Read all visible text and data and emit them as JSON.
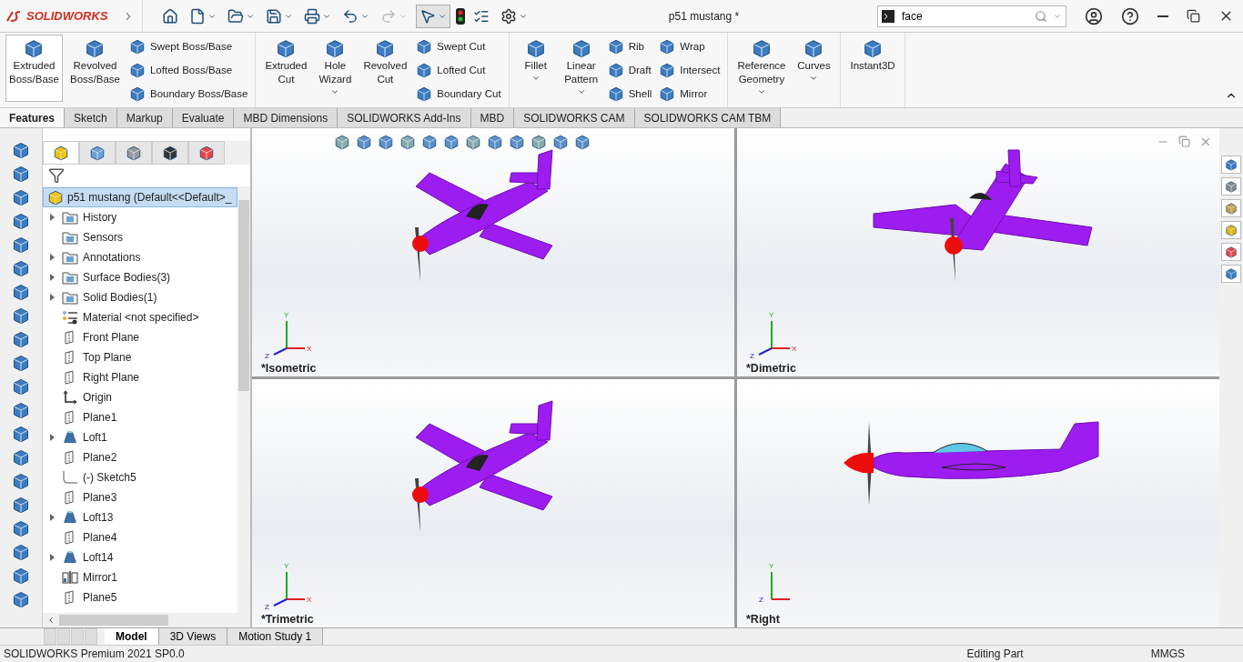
{
  "app": {
    "logo": "SOLIDWORKS",
    "title": "p51 mustang *",
    "search": {
      "value": "face"
    }
  },
  "ribbon": [
    {
      "items": [
        {
          "kind": "large",
          "lines": [
            "Extruded",
            "Boss/Base"
          ],
          "selected": true,
          "dropdown": false
        },
        {
          "kind": "large",
          "lines": [
            "Revolved",
            "Boss/Base"
          ],
          "selected": false,
          "dropdown": false
        },
        {
          "kind": "stack",
          "labels": [
            "Swept Boss/Base",
            "Lofted Boss/Base",
            "Boundary Boss/Base"
          ]
        }
      ]
    },
    {
      "items": [
        {
          "kind": "large",
          "lines": [
            "Extruded",
            "Cut"
          ],
          "selected": false,
          "dropdown": false
        },
        {
          "kind": "large",
          "lines": [
            "Hole",
            "Wizard"
          ],
          "selected": false,
          "dropdown": true
        },
        {
          "kind": "large",
          "lines": [
            "Revolved",
            "Cut"
          ],
          "selected": false,
          "dropdown": false
        },
        {
          "kind": "stack",
          "labels": [
            "Swept Cut",
            "Lofted Cut",
            "Boundary Cut"
          ]
        }
      ]
    },
    {
      "items": [
        {
          "kind": "large",
          "lines": [
            "Fillet"
          ],
          "selected": false,
          "dropdown": true
        },
        {
          "kind": "large",
          "lines": [
            "Linear",
            "Pattern"
          ],
          "selected": false,
          "dropdown": true
        },
        {
          "kind": "stack",
          "labels": [
            "Rib",
            "Draft",
            "Shell"
          ]
        },
        {
          "kind": "stack",
          "labels": [
            "Wrap",
            "Intersect",
            "Mirror"
          ]
        }
      ]
    },
    {
      "items": [
        {
          "kind": "large",
          "lines": [
            "Reference",
            "Geometry"
          ],
          "selected": false,
          "dropdown": true
        },
        {
          "kind": "large",
          "lines": [
            "Curves"
          ],
          "selected": false,
          "dropdown": true
        }
      ]
    },
    {
      "items": [
        {
          "kind": "large",
          "lines": [
            "Instant3D"
          ],
          "selected": false,
          "dropdown": false
        }
      ]
    }
  ],
  "command_tabs": [
    {
      "label": "Features",
      "selected": true
    },
    {
      "label": "Sketch",
      "selected": false
    },
    {
      "label": "Markup",
      "selected": false
    },
    {
      "label": "Evaluate",
      "selected": false
    },
    {
      "label": "MBD Dimensions",
      "selected": false
    },
    {
      "label": "SOLIDWORKS Add-Ins",
      "selected": false
    },
    {
      "label": "MBD",
      "selected": false
    },
    {
      "label": "SOLIDWORKS CAM",
      "selected": false
    },
    {
      "label": "SOLIDWORKS CAM TBM",
      "selected": false
    }
  ],
  "manager_tabs": [
    {
      "selected": true
    },
    {
      "selected": false
    },
    {
      "selected": false
    },
    {
      "selected": false
    },
    {
      "selected": false
    }
  ],
  "tree": {
    "root": {
      "label": "p51 mustang  (Default<<Default>_",
      "selected": true
    },
    "items": [
      {
        "label": "History",
        "kind": "folder",
        "expandable": true
      },
      {
        "label": "Sensors",
        "kind": "folder",
        "expandable": false
      },
      {
        "label": "Annotations",
        "kind": "folder",
        "expandable": true
      },
      {
        "label": "Surface Bodies(3)",
        "kind": "folder",
        "expandable": true
      },
      {
        "label": "Solid Bodies(1)",
        "kind": "folder",
        "expandable": true
      },
      {
        "label": "Material <not specified>",
        "kind": "material",
        "expandable": false
      },
      {
        "label": "Front Plane",
        "kind": "plane",
        "expandable": false
      },
      {
        "label": "Top Plane",
        "kind": "plane",
        "expandable": false
      },
      {
        "label": "Right Plane",
        "kind": "plane",
        "expandable": false
      },
      {
        "label": "Origin",
        "kind": "origin",
        "expandable": false
      },
      {
        "label": "Plane1",
        "kind": "plane",
        "expandable": false
      },
      {
        "label": "Loft1",
        "kind": "loft",
        "expandable": true
      },
      {
        "label": "Plane2",
        "kind": "plane",
        "expandable": false
      },
      {
        "label": "(-) Sketch5",
        "kind": "sketch",
        "expandable": false
      },
      {
        "label": "Plane3",
        "kind": "plane",
        "expandable": false
      },
      {
        "label": "Loft13",
        "kind": "loft",
        "expandable": true
      },
      {
        "label": "Plane4",
        "kind": "plane",
        "expandable": false
      },
      {
        "label": "Loft14",
        "kind": "loft",
        "expandable": true
      },
      {
        "label": "Mirror1",
        "kind": "mirror",
        "expandable": false
      },
      {
        "label": "Plane5",
        "kind": "plane",
        "expandable": false
      }
    ]
  },
  "bottom_tabs": [
    {
      "label": "Model",
      "selected": true
    },
    {
      "label": "3D Views",
      "selected": false
    },
    {
      "label": "Motion Study 1",
      "selected": false
    }
  ],
  "viewports": [
    {
      "label": "*Isometric",
      "kind": "isometric",
      "axes": [
        "X",
        "Y",
        "Z"
      ]
    },
    {
      "label": "*Dimetric",
      "kind": "dimetric",
      "axes": [
        "X",
        "Y",
        "Z"
      ]
    },
    {
      "label": "*Trimetric",
      "kind": "trimetric",
      "axes": [
        "X",
        "Y",
        "Z"
      ]
    },
    {
      "label": "*Right",
      "kind": "side",
      "axes": [
        "Y",
        "Z"
      ]
    }
  ],
  "status_bar": {
    "product": "SOLIDWORKS Premium 2021 SP0.0",
    "mode": "Editing Part",
    "units": "MMGS"
  }
}
